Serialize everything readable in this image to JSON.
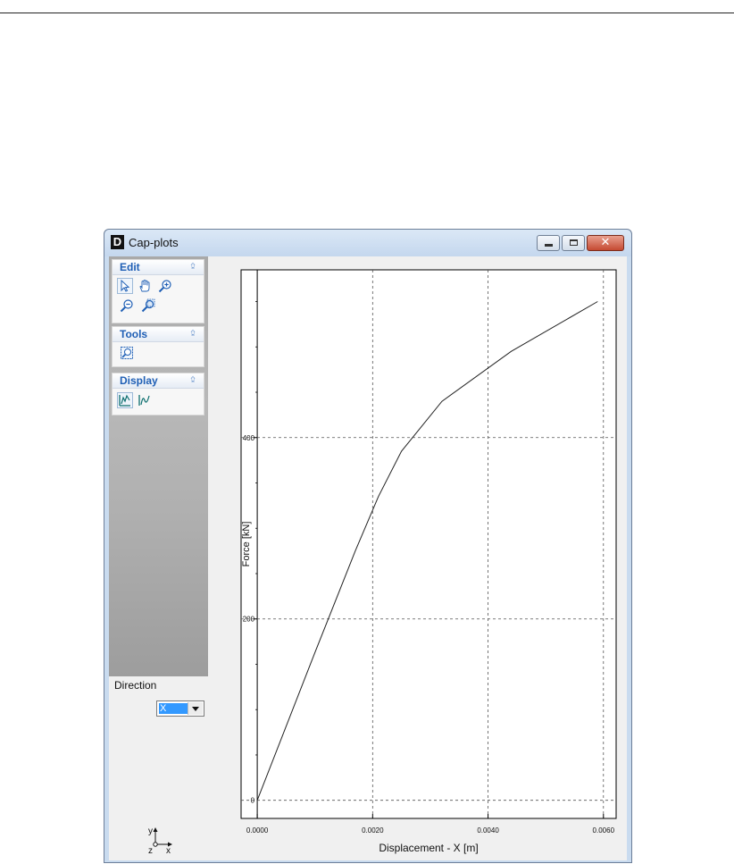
{
  "window": {
    "title": "Cap-plots",
    "app_icon_letter": "D"
  },
  "sidebar": {
    "panels": [
      {
        "title": "Edit",
        "tools": [
          "pointer-icon",
          "pan-hand-icon",
          "zoom-in-icon",
          "zoom-out-icon",
          "zoom-window-icon"
        ]
      },
      {
        "title": "Tools",
        "tools": [
          "select-region-icon"
        ]
      },
      {
        "title": "Display",
        "tools": [
          "display-values-icon",
          "display-curves-icon"
        ]
      }
    ],
    "direction_label": "Direction",
    "direction_value": "X",
    "axes_indicator": {
      "y": "y",
      "z": "z",
      "x": "x"
    }
  },
  "chart_data": {
    "type": "line",
    "xlabel": "Displacement  - X [m]",
    "ylabel": "Force [kN]",
    "xlim": [
      -0.00028,
      0.00622
    ],
    "ylim": [
      -20,
      585
    ],
    "x_ticks": [
      "0.0000",
      "0.0020",
      "0.0040",
      "0.0060"
    ],
    "x_tick_values": [
      0.0,
      0.002,
      0.004,
      0.006
    ],
    "y_ticks": [
      "0",
      "200",
      "400"
    ],
    "y_tick_values": [
      0,
      200,
      400
    ],
    "grid": true,
    "series": [
      {
        "x": [
          0.0,
          0.001,
          0.0017,
          0.0021,
          0.0025,
          0.0032,
          0.0044,
          0.0059
        ],
        "y": [
          0,
          163,
          275,
          335,
          385,
          440,
          495,
          550
        ]
      }
    ]
  }
}
